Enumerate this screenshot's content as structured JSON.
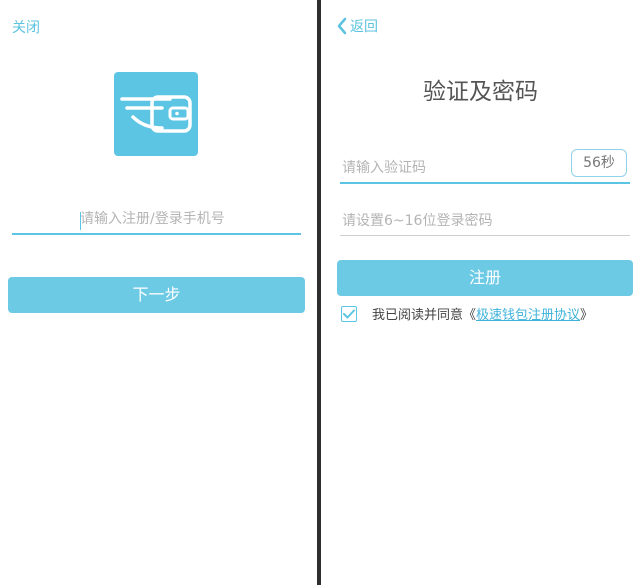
{
  "left_screen": {
    "close_label": "关闭",
    "phone_placeholder": "请输入注册/登录手机号",
    "next_button_label": "下一步",
    "logo_icon": "wallet-wing-icon"
  },
  "right_screen": {
    "back_label": "返回",
    "title": "验证及密码",
    "code_placeholder": "请输入验证码",
    "countdown_label": "56秒",
    "password_placeholder": "请设置6~16位登录密码",
    "register_button_label": "注册",
    "agree_prefix": "我已阅读并同意《",
    "agreement_link_text": "极速钱包注册协议",
    "agree_suffix": "》",
    "agree_checked": true
  },
  "colors": {
    "accent": "#5cc5e4",
    "button": "#6ccae5",
    "link": "#3fb3da",
    "divider": "#2e2e2e"
  }
}
